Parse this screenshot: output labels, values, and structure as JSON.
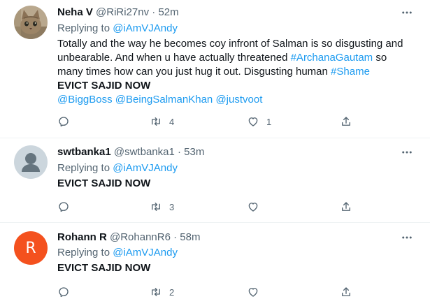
{
  "tweets": [
    {
      "name": "Neha V",
      "handle": "@RiRi27nv",
      "dot": "·",
      "time": "52m",
      "replying_label": "Replying to",
      "replying_to": "@iAmVJAndy",
      "text_1": "Totally and the way he becomes coy infront of Salman is so disgusting and unbearable. And when u have actually threatened ",
      "hashtag_1": "#ArchanaGautam",
      "text_2": " so many times how can you just hug it out. Disgusting human ",
      "hashtag_2": "#Shame",
      "evict": "EVICT SAJID NOW",
      "mention_1": "@BiggBoss",
      "mention_2": "@BeingSalmanKhan",
      "mention_3": "@justvoot",
      "reply_count": "",
      "retweet_count": "4",
      "like_count": "1",
      "avatar_icon": "cat-photo-avatar"
    },
    {
      "name": "swtbanka1",
      "handle": "@swtbanka1",
      "dot": "·",
      "time": "53m",
      "replying_label": "Replying to",
      "replying_to": "@iAmVJAndy",
      "evict": "EVICT SAJID NOW",
      "reply_count": "",
      "retweet_count": "3",
      "like_count": "",
      "avatar_icon": "default-user-avatar"
    },
    {
      "name": "Rohann R",
      "handle": "@RohannR6",
      "dot": "·",
      "time": "58m",
      "replying_label": "Replying to",
      "replying_to": "@iAmVJAndy",
      "evict": "EVICT SAJID NOW",
      "reply_count": "",
      "retweet_count": "2",
      "like_count": "",
      "avatar_letter": "R",
      "avatar_color": "#f4511e"
    }
  ],
  "colors": {
    "link": "#1d9bf0",
    "secondary_text": "#536471",
    "primary_text": "#0f1419",
    "divider": "#eff3f4"
  }
}
